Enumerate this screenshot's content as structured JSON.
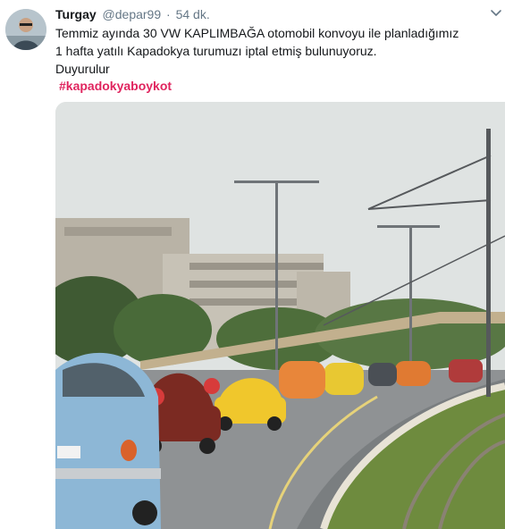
{
  "tweet": {
    "author_name": "Turgay",
    "author_handle": "@depar99",
    "separator": "·",
    "timestamp": "54 dk.",
    "text_lines": [
      "Temmiz ayında 30 VW KAPLIMBAĞA otomobil konvoyu ile planladığımız",
      "1 hafta yatılı Kapadokya turumuzı iptal etmiş bulunuyoruz.",
      "Duyurulur"
    ],
    "hashtag": "#kapadokyaboykot"
  },
  "icons": {
    "avatar": "user-avatar-photo",
    "more": "chevron-down-icon"
  },
  "colors": {
    "hashtag": "#e0245e",
    "secondary_text": "#657786"
  }
}
